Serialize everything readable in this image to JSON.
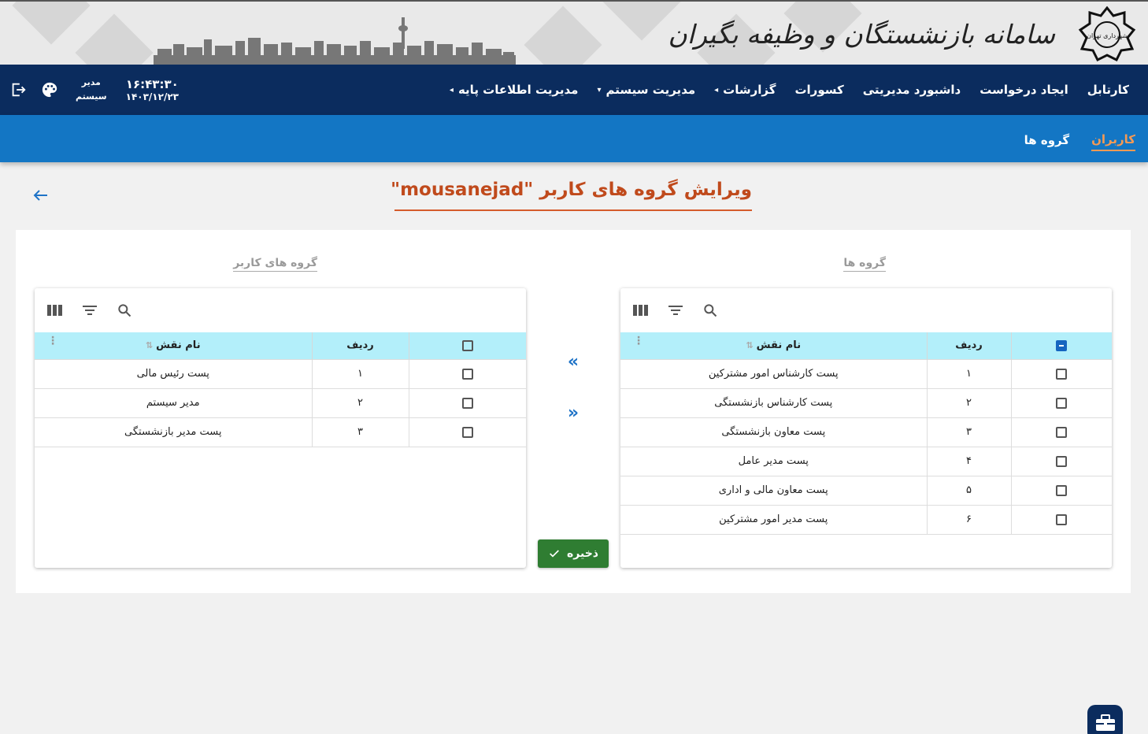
{
  "header": {
    "brand_title": "سامانه بازنشستگان و وظیفه بگیران",
    "emblem_text": "شهرداری تهران"
  },
  "nav": {
    "items": [
      {
        "label": "کارتابل",
        "caret": ""
      },
      {
        "label": "ایجاد درخواست",
        "caret": ""
      },
      {
        "label": "داشبورد مدیریتی",
        "caret": ""
      },
      {
        "label": "کسورات",
        "caret": ""
      },
      {
        "label": "گزارشات",
        "caret": "◂"
      },
      {
        "label": "مدیریت سیستم",
        "caret": "▾"
      },
      {
        "label": "مدیریت اطلاعات پایه",
        "caret": "◂"
      }
    ],
    "user_line1": "مدیر",
    "user_line2": "سیستم",
    "time": "۱۶:۴۳:۳۰",
    "date": "۱۴۰۳/۱۲/۲۳"
  },
  "subnav": {
    "items": [
      {
        "label": "کاربران",
        "active": true
      },
      {
        "label": "گروه ها",
        "active": false
      }
    ]
  },
  "page": {
    "title": "ویرایش گروه های کاربر \"mousanejad\""
  },
  "groups_panel": {
    "label": "گروه ها",
    "col_row": "ردیف",
    "col_name": "نام نقش",
    "rows": [
      {
        "index": "۱",
        "name": "پست کارشناس امور مشترکین"
      },
      {
        "index": "۲",
        "name": "پست کارشناس بازنشستگی"
      },
      {
        "index": "۳",
        "name": "پست معاون بازنشستگی"
      },
      {
        "index": "۴",
        "name": "پست مدیر عامل"
      },
      {
        "index": "۵",
        "name": "پست معاون مالی و اداری"
      },
      {
        "index": "۶",
        "name": "پست مدیر امور مشترکین"
      }
    ]
  },
  "user_groups_panel": {
    "label": "گروه های کاربر",
    "col_row": "ردیف",
    "col_name": "نام نقش",
    "rows": [
      {
        "index": "۱",
        "name": "پست رئیس مالی"
      },
      {
        "index": "۲",
        "name": "مدیر سیستم"
      },
      {
        "index": "۳",
        "name": "پست مدیر بازنشستگی"
      }
    ]
  },
  "actions": {
    "move_left": "«",
    "move_right": "»",
    "save_label": "ذخیره"
  },
  "colors": {
    "nav_bg": "#0b2c5e",
    "subnav_bg": "#1376c4",
    "header_row_bg": "#b3effa",
    "accent": "#c04a1c",
    "save_bg": "#2f7d32"
  }
}
